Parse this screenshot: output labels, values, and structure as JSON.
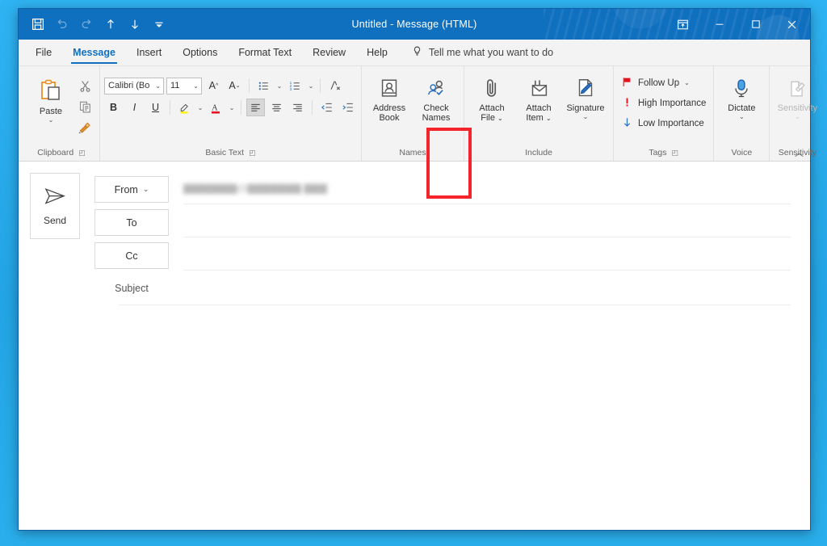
{
  "window": {
    "title": "Untitled  -  Message (HTML)",
    "titlebar_color": "#1070C0",
    "accent_color": "#1070C0",
    "highlight_color": "#F5242A"
  },
  "quick_access": [
    {
      "name": "save-icon",
      "label": "Save"
    },
    {
      "name": "undo-icon",
      "label": "Undo"
    },
    {
      "name": "redo-icon",
      "label": "Redo"
    },
    {
      "name": "previous-item-icon",
      "label": "Previous Item"
    },
    {
      "name": "next-item-icon",
      "label": "Next Item"
    },
    {
      "name": "customize-quick-access-toolbar-icon",
      "label": "Customize Quick Access Toolbar"
    }
  ],
  "window_controls": [
    {
      "name": "ribbon-display-options-icon",
      "label": "Ribbon Display Options"
    },
    {
      "name": "minimize-icon",
      "label": "Minimize"
    },
    {
      "name": "maximize-icon",
      "label": "Maximize"
    },
    {
      "name": "close-icon",
      "label": "Close"
    }
  ],
  "tabs": [
    {
      "label": "File",
      "active": false
    },
    {
      "label": "Message",
      "active": true
    },
    {
      "label": "Insert",
      "active": false
    },
    {
      "label": "Options",
      "active": false
    },
    {
      "label": "Format Text",
      "active": false
    },
    {
      "label": "Review",
      "active": false
    },
    {
      "label": "Help",
      "active": false
    }
  ],
  "tell_me": {
    "icon": "lightbulb-icon",
    "label": "Tell me what you want to do"
  },
  "ribbon": {
    "groups": [
      {
        "label": "Clipboard",
        "has_launcher": true
      },
      {
        "label": "Basic Text",
        "has_launcher": true
      },
      {
        "label": "Names",
        "has_launcher": false
      },
      {
        "label": "Include",
        "has_launcher": false
      },
      {
        "label": "Tags",
        "has_launcher": true
      },
      {
        "label": "Voice",
        "has_launcher": false
      },
      {
        "label": "Sensitivity",
        "has_launcher": false
      }
    ],
    "clipboard": {
      "paste_label": "Paste",
      "cut_label": "Cut",
      "copy_label": "Copy",
      "format_painter_label": "Format Painter"
    },
    "basic_text": {
      "font_name": "Calibri (Bo",
      "font_size": "11",
      "grow_font_label": "Increase Font Size",
      "shrink_font_label": "Decrease Font Size",
      "bullets_label": "Bullets",
      "numbering_label": "Numbering",
      "clear_formatting_label": "Clear All Formatting",
      "bold_label": "B",
      "italic_label": "I",
      "underline_label": "U",
      "highlight_label": "Text Highlight Color",
      "highlight_color": "#FFF200",
      "font_color_label": "Font Color",
      "font_color": "#E81123",
      "align_left_label": "Align Left",
      "align_center_label": "Center",
      "align_right_label": "Align Right",
      "decrease_indent_label": "Decrease Indent",
      "increase_indent_label": "Increase Indent"
    },
    "names": {
      "address_book_line1": "Address",
      "address_book_line2": "Book",
      "check_names_line1": "Check",
      "check_names_line2": "Names"
    },
    "include": {
      "attach_file_line1": "Attach",
      "attach_file_line2": "File",
      "attach_item_line1": "Attach",
      "attach_item_line2": "Item",
      "signature_label": "Signature",
      "highlighted_item": "Attach File"
    },
    "tags": {
      "follow_up_label": "Follow Up",
      "high_importance_label": "High Importance",
      "low_importance_label": "Low Importance"
    },
    "voice": {
      "dictate_label": "Dictate"
    },
    "sensitivity": {
      "sensitivity_label": "Sensitivity",
      "disabled": true
    },
    "collapse_label": "Collapse the Ribbon"
  },
  "compose": {
    "send_label": "Send",
    "from_label": "From",
    "from_value": "▇▇▇▇▇▇▇@▇▇▇▇▇▇▇.▇▇▇",
    "to_label": "To",
    "to_value": "",
    "cc_label": "Cc",
    "cc_value": "",
    "subject_label": "Subject",
    "subject_value": "",
    "body_value": ""
  }
}
